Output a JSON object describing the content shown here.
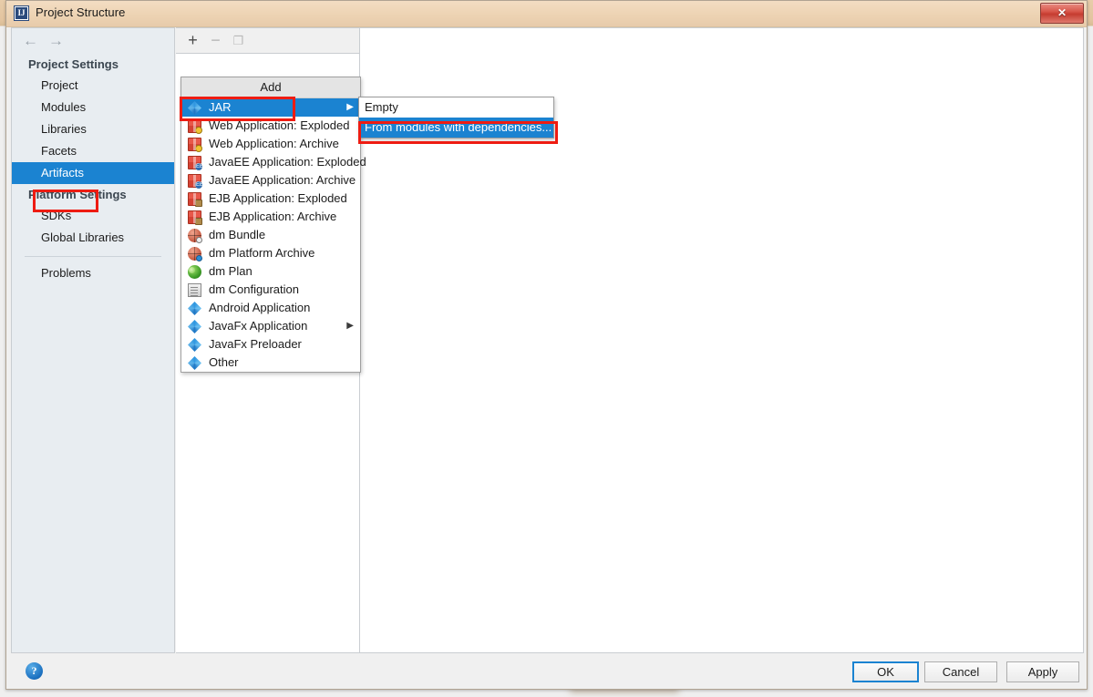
{
  "window": {
    "title": "Project Structure",
    "app_icon": "intellij-idea-icon",
    "close_label": "✕"
  },
  "sidebar": {
    "back_icon": "←",
    "forward_icon": "→",
    "groups": [
      {
        "title": "Project Settings",
        "items": [
          {
            "label": "Project",
            "selected": false
          },
          {
            "label": "Modules",
            "selected": false
          },
          {
            "label": "Libraries",
            "selected": false
          },
          {
            "label": "Facets",
            "selected": false
          },
          {
            "label": "Artifacts",
            "selected": true
          }
        ]
      },
      {
        "title": "Platform Settings",
        "items": [
          {
            "label": "SDKs",
            "selected": false
          },
          {
            "label": "Global Libraries",
            "selected": false
          }
        ]
      }
    ],
    "problems_label": "Problems"
  },
  "list_toolbar": {
    "add_icon": "+",
    "remove_icon": "−",
    "copy_icon": "❐"
  },
  "add_menu": {
    "header": "Add",
    "items": [
      {
        "label": "JAR",
        "icon": "diamond-icon",
        "highlight": true,
        "submenu": true
      },
      {
        "label": "Web Application: Exploded",
        "icon": "package-ok-icon",
        "highlight": false,
        "submenu": false
      },
      {
        "label": "Web Application: Archive",
        "icon": "package-ok-icon",
        "highlight": false,
        "submenu": false
      },
      {
        "label": "JavaEE Application: Exploded",
        "icon": "package-ee-icon",
        "highlight": false,
        "submenu": false
      },
      {
        "label": "JavaEE Application: Archive",
        "icon": "package-ee-icon",
        "highlight": false,
        "submenu": false
      },
      {
        "label": "EJB Application: Exploded",
        "icon": "package-ejb-icon",
        "highlight": false,
        "submenu": false
      },
      {
        "label": "EJB Application: Archive",
        "icon": "package-ejb-icon",
        "highlight": false,
        "submenu": false
      },
      {
        "label": "dm Bundle",
        "icon": "globe-icon",
        "highlight": false,
        "submenu": false
      },
      {
        "label": "dm Platform Archive",
        "icon": "globe-blue-icon",
        "highlight": false,
        "submenu": false
      },
      {
        "label": "dm Plan",
        "icon": "leaf-globe-icon",
        "highlight": false,
        "submenu": false
      },
      {
        "label": "dm Configuration",
        "icon": "document-icon",
        "highlight": false,
        "submenu": false
      },
      {
        "label": "Android Application",
        "icon": "diamond-icon",
        "highlight": false,
        "submenu": false
      },
      {
        "label": "JavaFx Application",
        "icon": "diamond-icon",
        "highlight": false,
        "submenu": true
      },
      {
        "label": "JavaFx Preloader",
        "icon": "diamond-icon",
        "highlight": false,
        "submenu": false
      },
      {
        "label": "Other",
        "icon": "diamond-icon",
        "highlight": false,
        "submenu": false
      }
    ],
    "submenu_arrow": "▶"
  },
  "jar_submenu": {
    "items": [
      {
        "label": "Empty",
        "highlight": false
      },
      {
        "label": "From modules with dependencies...",
        "highlight": true
      }
    ]
  },
  "footer": {
    "help_icon": "?",
    "ok_label": "OK",
    "cancel_label": "Cancel",
    "apply_label": "Apply"
  },
  "annotations": [
    {
      "name": "artifacts-highlight"
    },
    {
      "name": "jar-highlight"
    },
    {
      "name": "from-modules-highlight"
    }
  ],
  "colors": {
    "selection_blue": "#1b83d1",
    "annotation_red": "#ee1c12",
    "sidebar_bg": "#e8edf1",
    "titlebar_bg": "#edd3b3"
  }
}
